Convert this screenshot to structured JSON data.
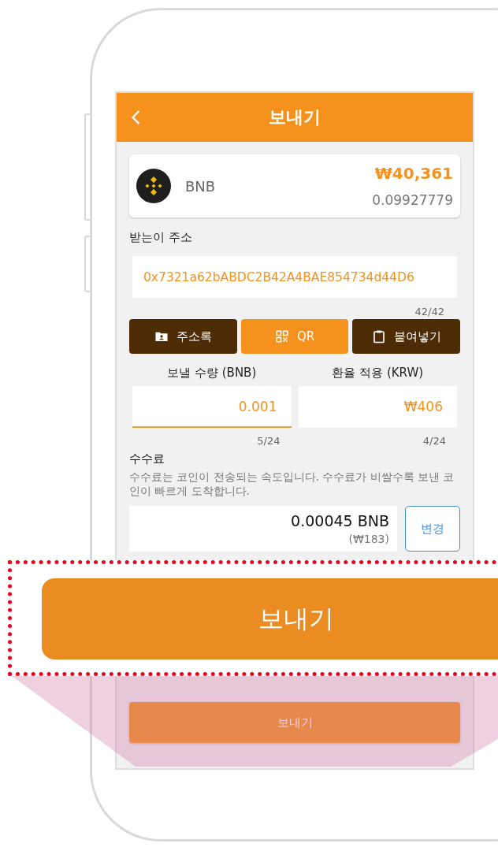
{
  "header": {
    "title": "보내기"
  },
  "coin": {
    "symbol": "BNB",
    "krw_value": "₩40,361",
    "balance": "0.09927779"
  },
  "recipient": {
    "label": "받는이 주소",
    "value": "0x7321a62bABDC2B42A4BAE854734d44D6",
    "counter": "42/42"
  },
  "actions": [
    {
      "kind": "address_book",
      "label": "주소록",
      "selected": false
    },
    {
      "kind": "qr",
      "label": "QR",
      "selected": true
    },
    {
      "kind": "paste",
      "label": "붙여넣기",
      "selected": false
    }
  ],
  "amounts": [
    {
      "label": "보낼 수량 (BNB)",
      "value": "0.001",
      "counter": "5/24",
      "focused": true
    },
    {
      "label": "환율 적용 (KRW)",
      "value": "₩406",
      "counter": "4/24",
      "focused": false
    }
  ],
  "fee": {
    "title": "수수료",
    "description": "수수료는 코인이 전송되는 속도입니다. 수수료가 비쌀수록 보낸 코인이 빠르게 도착합니다.",
    "amount": "0.00045 BNB",
    "krw": "(₩183)",
    "change_button": "변경"
  },
  "send_button": {
    "label": "보내기"
  },
  "callout": {
    "label": "보내기"
  }
}
